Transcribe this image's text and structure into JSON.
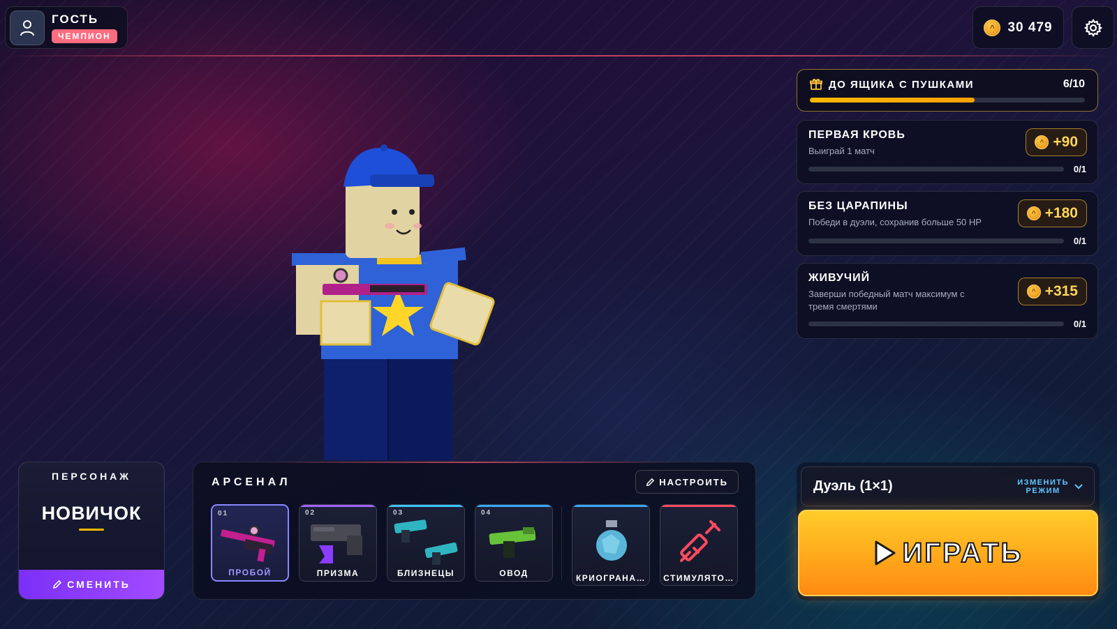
{
  "profile": {
    "name": "ГОСТЬ",
    "rank": "ЧЕМПИОН"
  },
  "currency": {
    "coins": "30 479"
  },
  "crate": {
    "title": "ДО ЯЩИКА С ПУШКАМИ",
    "count": "6/10",
    "progress": 0.6
  },
  "quests": [
    {
      "title": "ПЕРВАЯ КРОВЬ",
      "desc": "Выиграй 1 матч",
      "reward": "+90",
      "progress": "0/1"
    },
    {
      "title": "БЕЗ ЦАРАПИНЫ",
      "desc": "Победи в дуэли, сохранив больше 50 HP",
      "reward": "+180",
      "progress": "0/1"
    },
    {
      "title": "ЖИВУЧИЙ",
      "desc": "Заверши победный матч максимум с тремя смертями",
      "reward": "+315",
      "progress": "0/1"
    }
  ],
  "character": {
    "label": "ПЕРСОНАЖ",
    "name": "НОВИЧОК",
    "change_label": "СМЕНИТЬ"
  },
  "arsenal": {
    "title": "АРСЕНАЛ",
    "configure_label": "НАСТРОИТЬ",
    "slots": [
      {
        "num": "01",
        "label": "ПРОБОЙ",
        "selected": true,
        "accent": "#8b87ff"
      },
      {
        "num": "02",
        "label": "ПРИЗМА",
        "accent": "#a064ff"
      },
      {
        "num": "03",
        "label": "БЛИЗНЕЦЫ",
        "accent": "#39c7ff"
      },
      {
        "num": "04",
        "label": "ОВОД",
        "accent": "#39a8ff"
      },
      {
        "num": "",
        "label": "КРИОГРАНА…",
        "accent": "#39a8ff"
      },
      {
        "num": "",
        "label": "СТИМУЛЯТО…",
        "accent": "#ff4a5e"
      }
    ]
  },
  "mode": {
    "name": "Дуэль (1×1)",
    "change_line1": "ИЗМЕНИТЬ",
    "change_line2": "РЕЖИМ"
  },
  "play": {
    "label": "ИГРАТЬ"
  },
  "icons": {
    "profile": "user-icon",
    "settings": "gear-icon",
    "crate": "gift-icon",
    "coin": "coin-icon",
    "edit": "pencil-icon",
    "play": "play-icon",
    "dropdown": "chevron-down-icon"
  }
}
